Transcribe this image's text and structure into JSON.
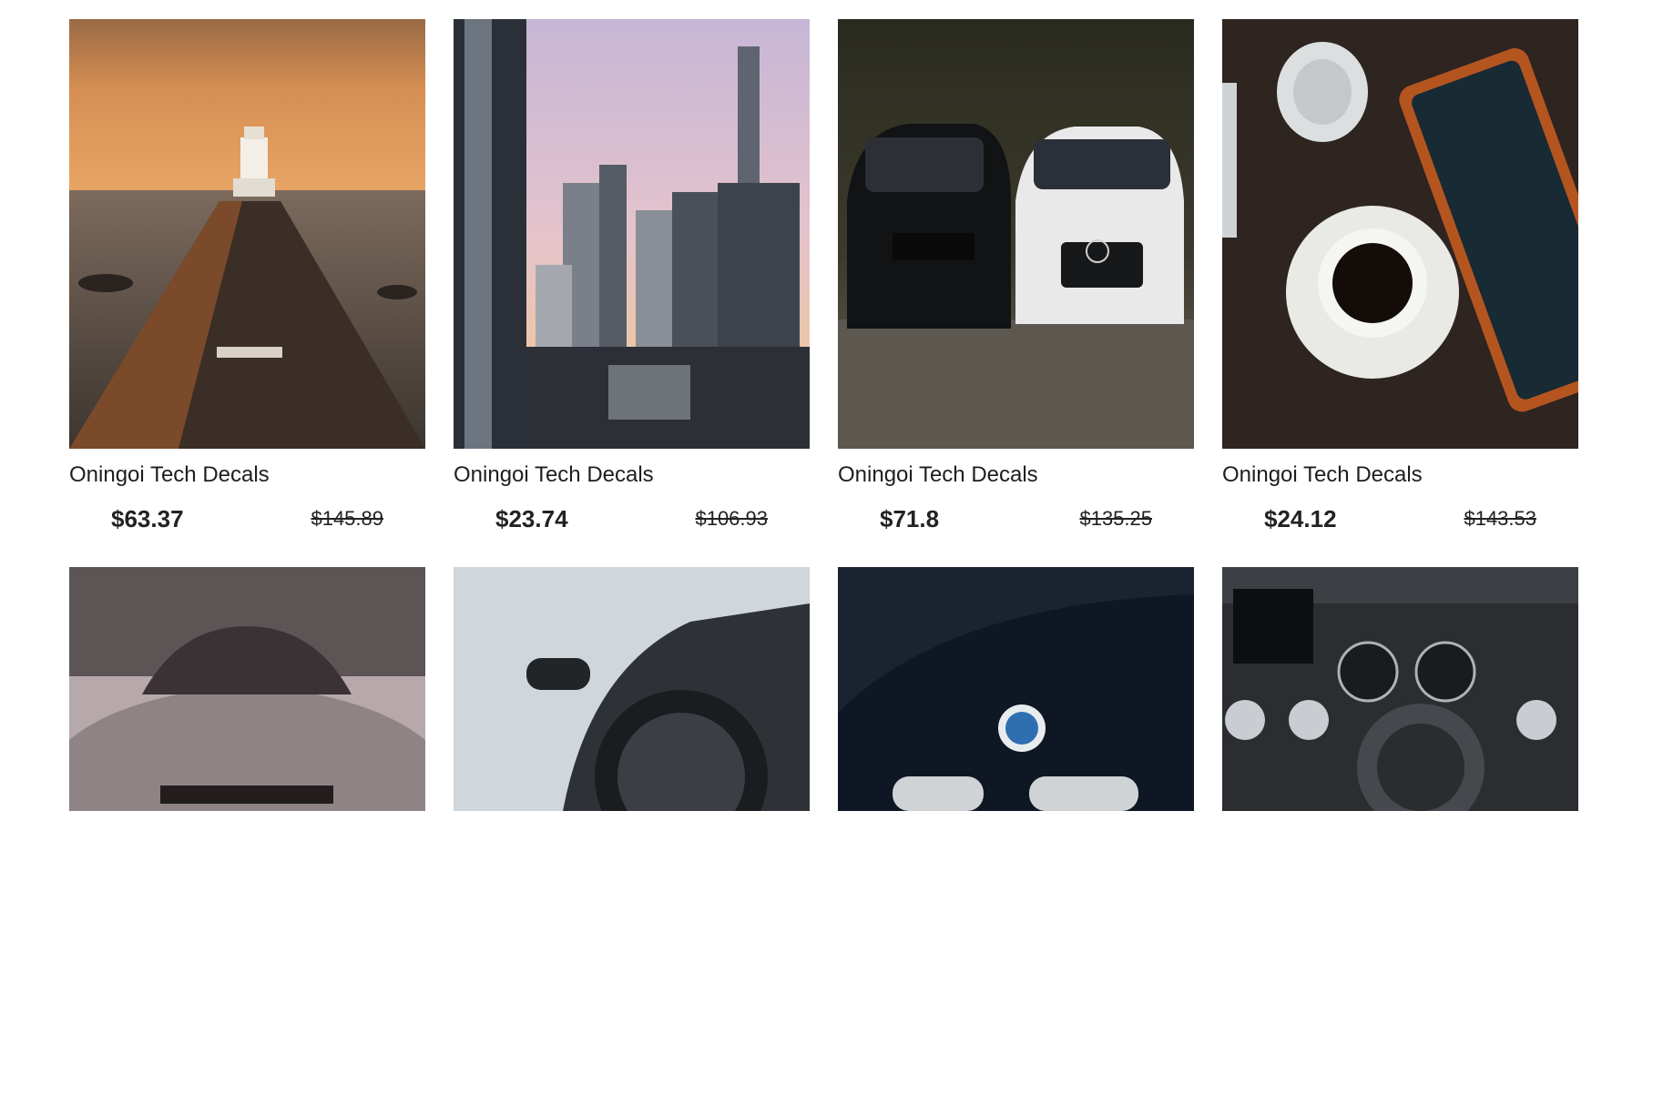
{
  "products_row1": [
    {
      "title": "Oningoi Tech Decals",
      "price": "$63.37",
      "original_price": "$145.89",
      "image": "lighthouse-pier-sunset"
    },
    {
      "title": "Oningoi Tech Decals",
      "price": "$23.74",
      "original_price": "$106.93",
      "image": "city-skyline-dusk"
    },
    {
      "title": "Oningoi Tech Decals",
      "price": "$71.8",
      "original_price": "$135.25",
      "image": "black-bmw-white-audi"
    },
    {
      "title": "Oningoi Tech Decals",
      "price": "$24.12",
      "original_price": "$143.53",
      "image": "coffee-headphones-tablet"
    }
  ],
  "products_row2": [
    {
      "image": "car-hood-rain"
    },
    {
      "image": "car-wheel-closeup"
    },
    {
      "image": "bmw-hood-logo"
    },
    {
      "image": "audi-dashboard-interior"
    }
  ],
  "colors": {
    "background": "#ffffff",
    "text": "#1e1e1e"
  }
}
